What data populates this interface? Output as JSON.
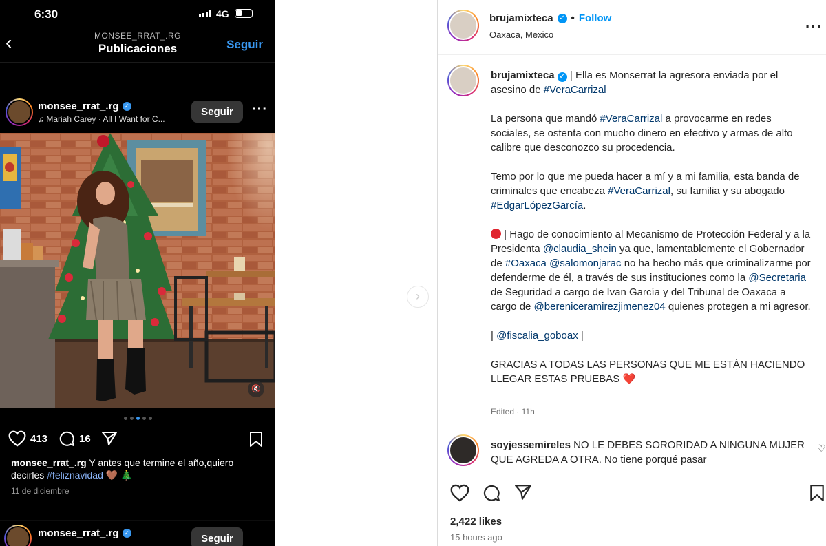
{
  "phone": {
    "status": {
      "time": "6:30",
      "network": "4G"
    },
    "nav": {
      "subtitle": "MONSEE_RRAT_.RG",
      "title": "Publicaciones",
      "follow_label": "Seguir"
    },
    "post": {
      "username": "monsee_rrat_.rg",
      "song": "♫ Mariah Carey · All I Want for C...",
      "follow_label": "Seguir",
      "likes": "413",
      "comments": "16",
      "caption_user": "monsee_rrat_.rg",
      "caption_text": "Y antes que termine el año,quiero decirles",
      "caption_tag": "#feliznavidad",
      "caption_emoji": "🤎 🎄",
      "date": "11 de diciembre",
      "carousel": {
        "count": 5,
        "active_index": 2
      }
    },
    "next_post": {
      "username": "monsee_rrat_.rg",
      "follow_label": "Seguir"
    }
  },
  "panel": {
    "header": {
      "username": "brujamixteca",
      "follow_label": "Follow",
      "location": "Oaxaca, Mexico"
    },
    "caption": {
      "username": "brujamixteca",
      "p1_text": "| Ella es Monserrat la agresora enviada por el asesino de",
      "p1_tag": "#VeraCarrizal",
      "p2_a": "La persona que mandó",
      "p2_tag": "#VeraCarrizal",
      "p2_b": "a provocarme en redes sociales, se ostenta con mucho dinero en efectivo y armas de alto calibre que desconozco su procedencia.",
      "p3_a": "Temo por lo que me pueda hacer a mí y a mi familia, esta banda de criminales que encabeza",
      "p3_tag": "#VeraCarrizal",
      "p3_b": ", su familia y su abogado",
      "p3_tag2": "#EdgarLópezGarcía",
      "p3_c": ".",
      "p4_a": "| Hago de conocimiento al Mecanismo de Protección Federal y a la Presidenta",
      "p4_m1": "@claudia_shein",
      "p4_b": "ya que, lamentablemente el Gobernador de",
      "p4_t1": "#Oaxaca",
      "p4_m2": "@salomonjarac",
      "p4_c": "no ha hecho más que criminalizarme por defenderme de él, a través de sus instituciones como la",
      "p4_m3": "@Secretaria",
      "p4_d": "de Seguridad a cargo de Ivan García y del Tribunal de Oaxaca a cargo de",
      "p4_m4": "@bereniceramirezjimenez04",
      "p4_e": "quienes protegen a mi agresor.",
      "p5_a": "|",
      "p5_m": "@fiscalia_goboax",
      "p5_b": "|",
      "p6_text": "GRACIAS A TODAS LAS PERSONAS QUE ME ESTÁN HACIENDO LLEGAR ESTAS PRUEBAS",
      "p6_emoji": "❤️",
      "edited": "Edited · 11h"
    },
    "comment": {
      "username": "soyjessemireles",
      "text": "NO LE DEBES SORORIDAD A NINGUNA MUJER QUE AGREDA A OTRA. No tiene porqué pasar"
    },
    "footer": {
      "likes": "2,422 likes",
      "time_ago": "15 hours ago"
    }
  },
  "icons": [
    "heart-icon",
    "comment-icon",
    "share-icon",
    "bookmark-icon",
    "more-icon",
    "back-icon",
    "verified-icon",
    "music-note-icon",
    "mute-icon",
    "chevron-right-icon"
  ]
}
